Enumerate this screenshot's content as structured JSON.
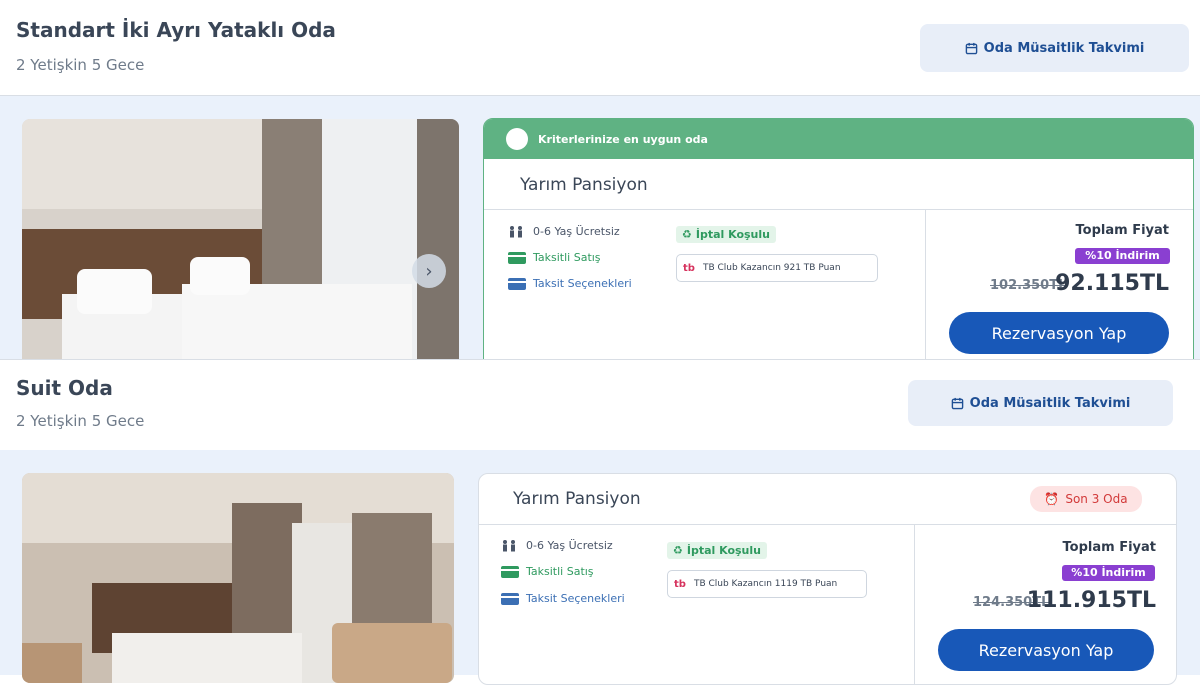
{
  "rooms": [
    {
      "title": "Standart İki Ayrı Yataklı Oda",
      "guests": "2 Yetişkin 5 Gece",
      "calendar_label": "Oda Müsaitlik Takvimi",
      "best_match": "Kriterlerinize en uygun oda",
      "board": "Yarım Pansiyon",
      "features": {
        "kids": "0-6 Yaş Ücretsiz",
        "installment": "Taksitli Satış",
        "options": "Taksit Seçenekleri"
      },
      "cancel_label": "İptal Koşulu",
      "club_logo": "tb",
      "club_text": "TB Club Kazancın  921 TB Puan",
      "total_label": "Toplam Fiyat",
      "discount": "%10 İndirim",
      "old_price": "102.350TL",
      "new_price": "92.115TL",
      "reserve_label": "Rezervasyon Yap"
    },
    {
      "title": "Suit Oda",
      "guests": "2 Yetişkin 5 Gece",
      "calendar_label": "Oda Müsaitlik Takvimi",
      "board": "Yarım Pansiyon",
      "scarcity": "Son 3 Oda",
      "features": {
        "kids": "0-6 Yaş Ücretsiz",
        "installment": "Taksitli Satış",
        "options": "Taksit Seçenekleri"
      },
      "cancel_label": "İptal Koşulu",
      "club_logo": "tb",
      "club_text": "TB Club Kazancın  1119 TB Puan",
      "total_label": "Toplam Fiyat",
      "discount": "%10 İndirim",
      "old_price": "124.350TL",
      "new_price": "111.915TL",
      "reserve_label": "Rezervasyon Yap"
    }
  ],
  "colors": {
    "accent": "#1858b8",
    "best_match": "#5fb283",
    "discount": "#8a3fd1",
    "scarcity": "#d23a3a",
    "background": "#eaf1fb"
  },
  "icons": [
    "calendar-icon",
    "child-icon",
    "credit-card-icon",
    "cancel-policy-icon",
    "chevron-right-icon",
    "alarm-icon"
  ]
}
